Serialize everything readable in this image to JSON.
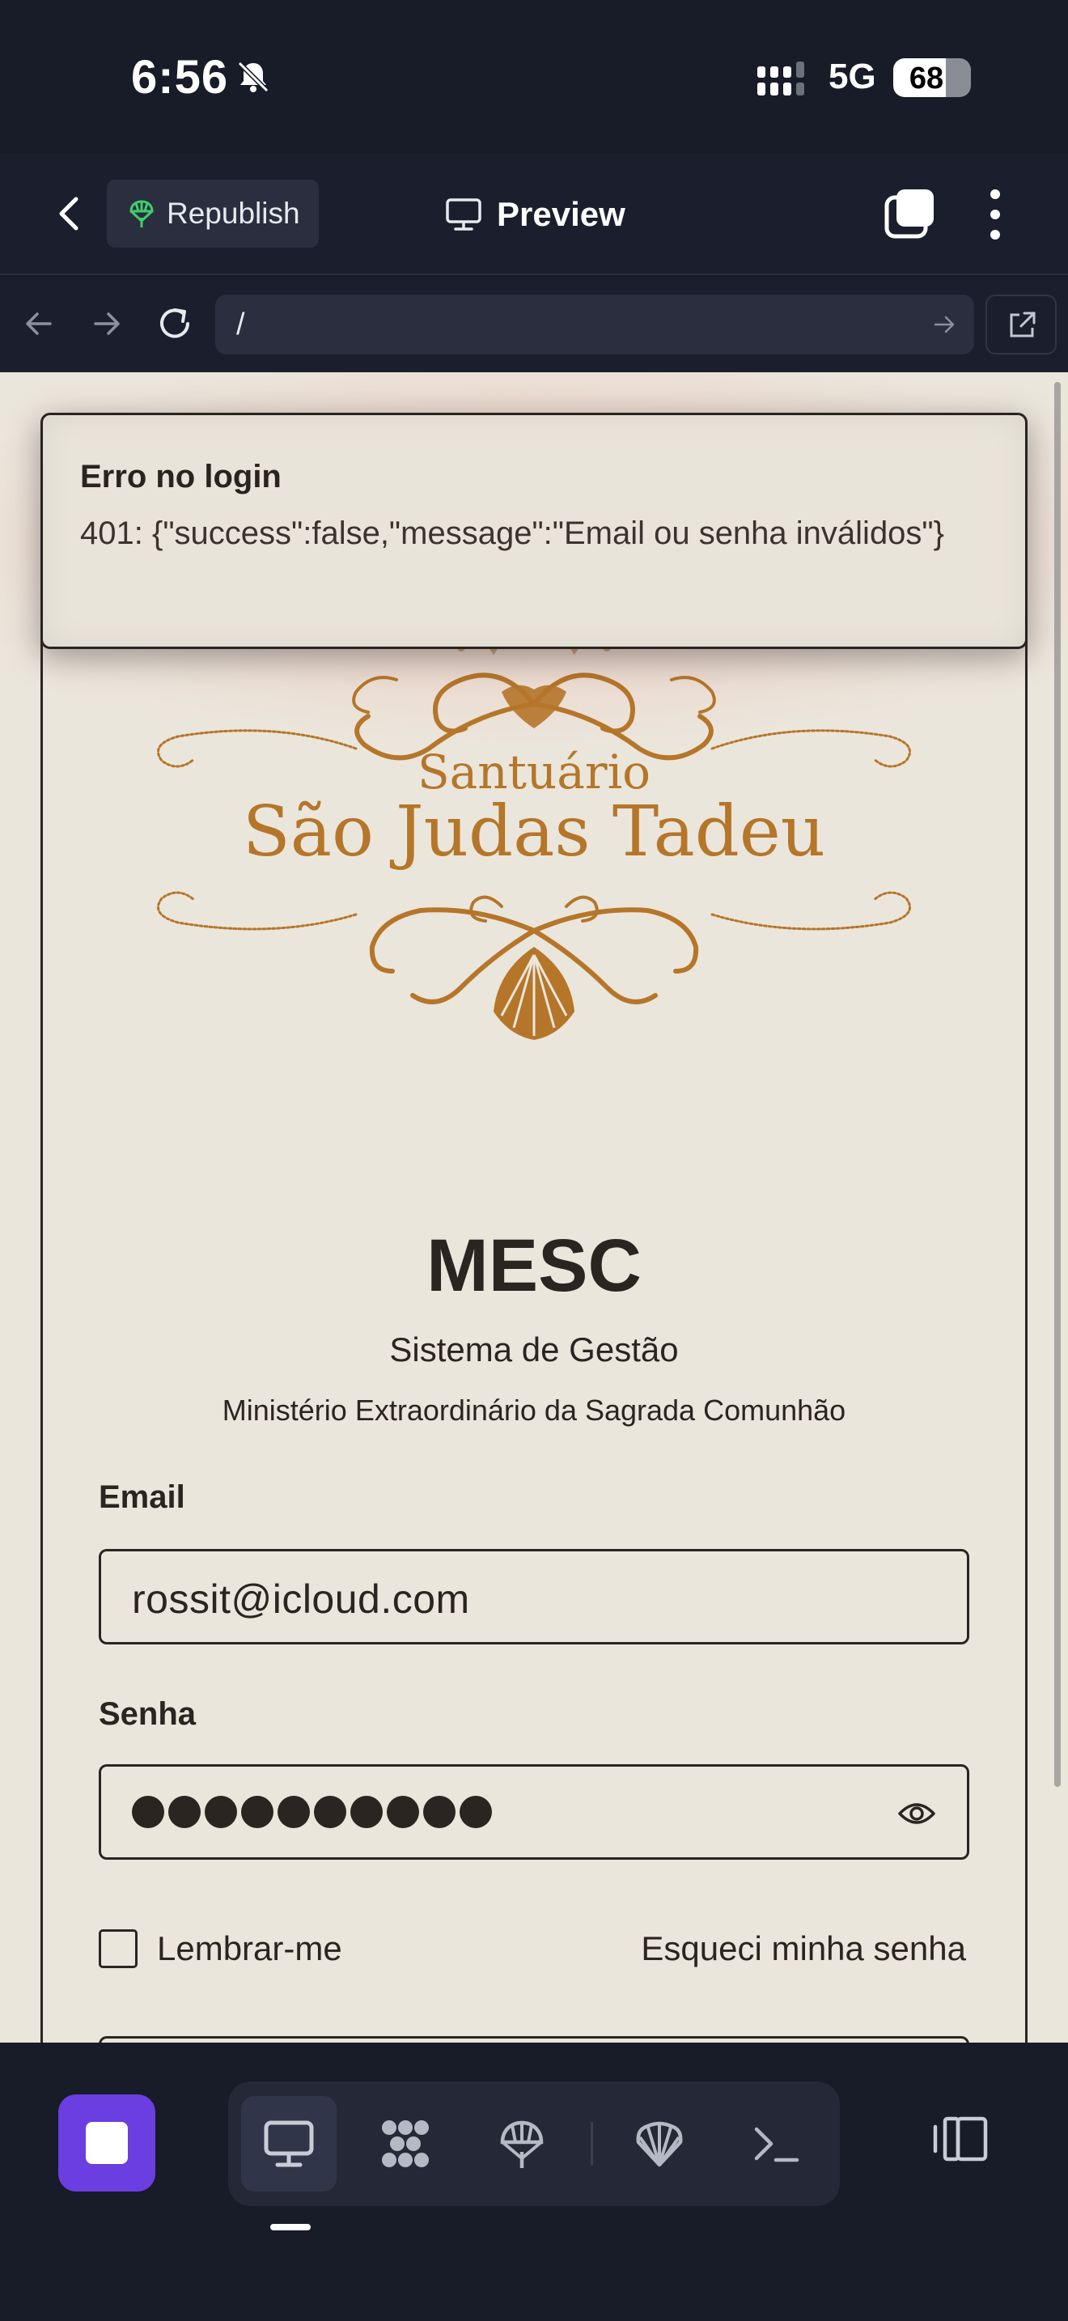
{
  "status_bar": {
    "time": "6:56",
    "network": "5G",
    "battery": "68",
    "battery_level": 0.68,
    "icons": [
      "bell-slash-icon",
      "signal-bars-icon",
      "battery-icon"
    ]
  },
  "app_bar": {
    "republish_label": "Republish",
    "preview_label": "Preview",
    "icons": [
      "chevron-left-icon",
      "republish-icon",
      "monitor-icon",
      "tabs-icon",
      "more-vertical-icon"
    ]
  },
  "browser": {
    "url": "/",
    "icons": [
      "arrow-left-icon",
      "arrow-right-icon",
      "reload-icon",
      "go-arrow-icon",
      "external-link-icon"
    ]
  },
  "toast": {
    "title": "Erro no login",
    "message": "401: {\"success\":false,\"message\":\"Email ou senha inválidos\"}"
  },
  "logo": {
    "line1": "Santuário",
    "line2": "São Judas Tadeu"
  },
  "login": {
    "title": "MESC",
    "subtitle": "Sistema de Gestão",
    "tagline": "Ministério Extraordinário da Sagrada Comunhão",
    "email_label": "Email",
    "email_value": "rossit@icloud.com",
    "password_label": "Senha",
    "password_masked_length": 10,
    "remember_label": "Lembrar-me",
    "remember_checked": false,
    "forgot_label": "Esqueci minha senha"
  },
  "bottom_toolbar": {
    "tools": [
      "stop-icon",
      "preview-monitor-icon",
      "workflow-icon",
      "deploy-icon",
      "shell-icon",
      "console-icon",
      "layout-icon"
    ],
    "active_tool": "preview-monitor-icon",
    "accent": "#6a3ee0"
  },
  "colors": {
    "chrome_bg": "#181b28",
    "page_bg": "#ebe6dc",
    "gold": "#b5762a",
    "text_dark": "#2a2520",
    "republish_green": "#3fcf6a"
  }
}
